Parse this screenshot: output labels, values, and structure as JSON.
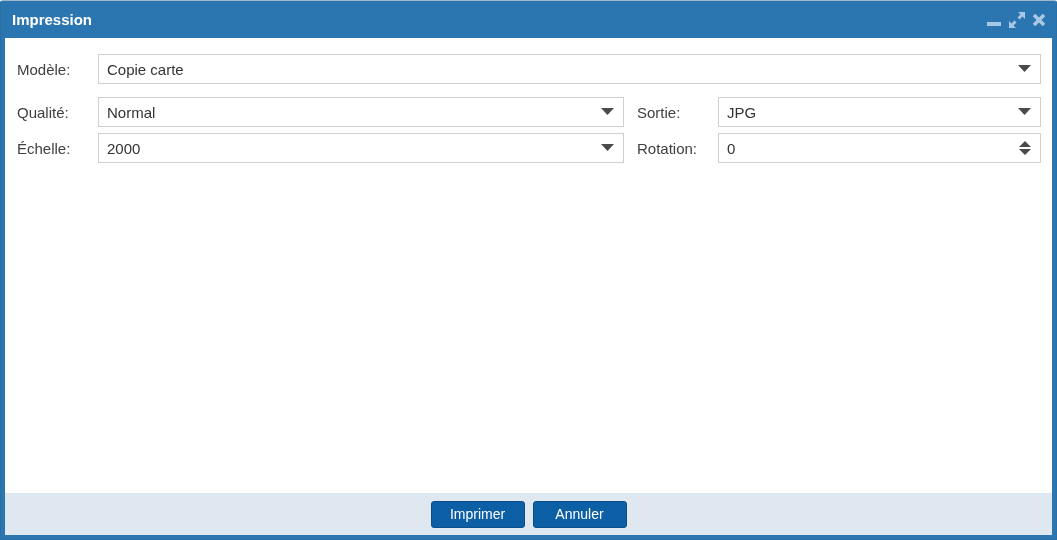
{
  "window": {
    "title": "Impression"
  },
  "form": {
    "rows": [
      [
        {
          "label": "Modèle:",
          "value": "Copie carte",
          "kind": "combo"
        }
      ],
      [
        {
          "label": "Qualité:",
          "value": "Normal",
          "kind": "combo"
        },
        {
          "label": "Sortie:",
          "value": "JPG",
          "kind": "combo"
        }
      ],
      [
        {
          "label": "Échelle:",
          "value": "2000",
          "kind": "combo"
        },
        {
          "label": "Rotation:",
          "value": "0",
          "kind": "spinner"
        }
      ]
    ]
  },
  "buttons": [
    "Imprimer",
    "Annuler"
  ]
}
